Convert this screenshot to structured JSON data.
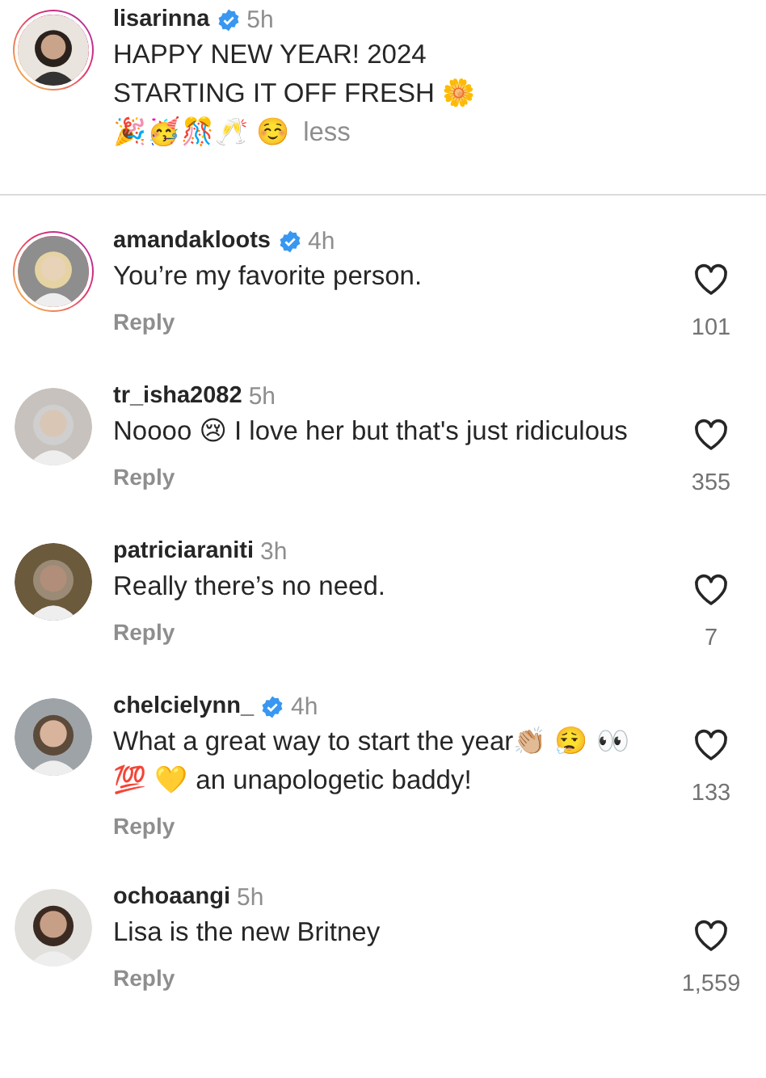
{
  "caption": {
    "username": "lisarinna",
    "verified": true,
    "story_ring": true,
    "time": "5h",
    "lines": [
      "HAPPY NEW YEAR! 2024",
      "STARTING IT OFF FRESH 🌼"
    ],
    "emoji_line": "🎉🥳🎊🥂 ☺️",
    "toggle": "less"
  },
  "comments": [
    {
      "username": "amandakloots",
      "verified": true,
      "story_ring": true,
      "time": "4h",
      "text": "You’re my favorite person.",
      "reply": "Reply",
      "likes": "101"
    },
    {
      "username": "tr_isha2082",
      "verified": false,
      "story_ring": false,
      "time": "5h",
      "text": "Noooo 😢 I love her but that's just ridiculous",
      "reply": "Reply",
      "likes": "355"
    },
    {
      "username": "patriciaraniti",
      "verified": false,
      "story_ring": false,
      "time": "3h",
      "text": "Really there’s no need.",
      "reply": "Reply",
      "likes": "7"
    },
    {
      "username": "chelcielynn_",
      "verified": true,
      "story_ring": false,
      "time": "4h",
      "text": "What a great way to start the year👏🏼 😮‍💨 👀 💯 💛  an unapologetic baddy!",
      "reply": "Reply",
      "likes": "133"
    },
    {
      "username": "ochoaangi",
      "verified": false,
      "story_ring": false,
      "time": "5h",
      "text": "Lisa is the new Britney",
      "reply": "Reply",
      "likes": "1,559"
    }
  ]
}
